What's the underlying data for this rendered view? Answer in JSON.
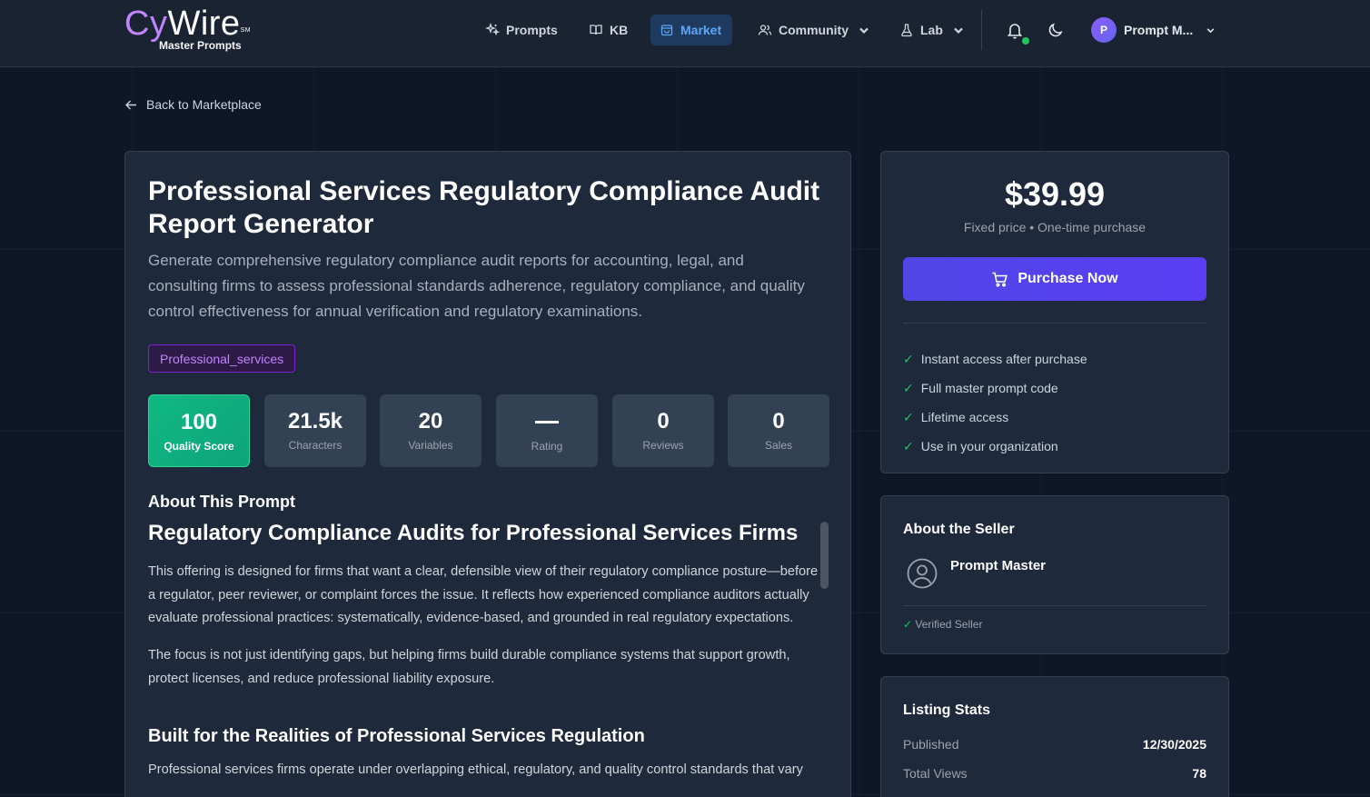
{
  "header": {
    "logo_cy": "Cy",
    "logo_wire": "Wire",
    "logo_sm": "SM",
    "logo_sub": "Master Prompts",
    "nav": [
      {
        "label": "Prompts",
        "icon": "sparkles-icon"
      },
      {
        "label": "KB",
        "icon": "book-icon"
      },
      {
        "label": "Market",
        "icon": "bag-icon",
        "active": true
      },
      {
        "label": "Community",
        "icon": "users-icon",
        "dropdown": true
      },
      {
        "label": "Lab",
        "icon": "flask-icon",
        "dropdown": true
      }
    ],
    "user_initial": "P",
    "user_name": "Prompt M...",
    "notification_status_color": "#22c55e"
  },
  "back_link": "Back to Marketplace",
  "listing": {
    "title": "Professional Services Regulatory Compliance Audit Report Generator",
    "description": "Generate comprehensive regulatory compliance audit reports for accounting, legal, and consulting firms to assess professional standards adherence, regulatory compliance, and quality control effectiveness for annual verification and regulatory examinations.",
    "tag": "Professional_services",
    "stats": [
      {
        "value": "100",
        "label": "Quality Score"
      },
      {
        "value": "21.5k",
        "label": "Characters"
      },
      {
        "value": "20",
        "label": "Variables"
      },
      {
        "value": "—",
        "label": "Rating"
      },
      {
        "value": "0",
        "label": "Reviews"
      },
      {
        "value": "0",
        "label": "Sales"
      }
    ],
    "about_heading": "About This Prompt",
    "content": {
      "h2": "Regulatory Compliance Audits for Professional Services Firms",
      "p1": "This offering is designed for firms that want a clear, defensible view of their regulatory compliance posture—before a regulator, peer reviewer, or complaint forces the issue. It reflects how experienced compliance auditors actually evaluate professional practices: systematically, evidence-based, and grounded in real regulatory expectations.",
      "p2": "The focus is not just identifying gaps, but helping firms build durable compliance systems that support growth, protect licenses, and reduce professional liability exposure.",
      "h3": "Built for the Realities of Professional Services Regulation",
      "p3": "Professional services firms operate under overlapping ethical, regulatory, and quality control standards that vary"
    }
  },
  "purchase": {
    "price": "$39.99",
    "price_note": "Fixed price • One-time purchase",
    "button": "Purchase Now",
    "features": [
      "Instant access after purchase",
      "Full master prompt code",
      "Lifetime access",
      "Use in your organization"
    ],
    "accent": "#4f46e5"
  },
  "seller": {
    "heading": "About the Seller",
    "name": "Prompt Master",
    "verified": "Verified Seller"
  },
  "listing_stats": {
    "heading": "Listing Stats",
    "rows": [
      {
        "label": "Published",
        "value": "12/30/2025"
      },
      {
        "label": "Total Views",
        "value": "78"
      }
    ]
  }
}
